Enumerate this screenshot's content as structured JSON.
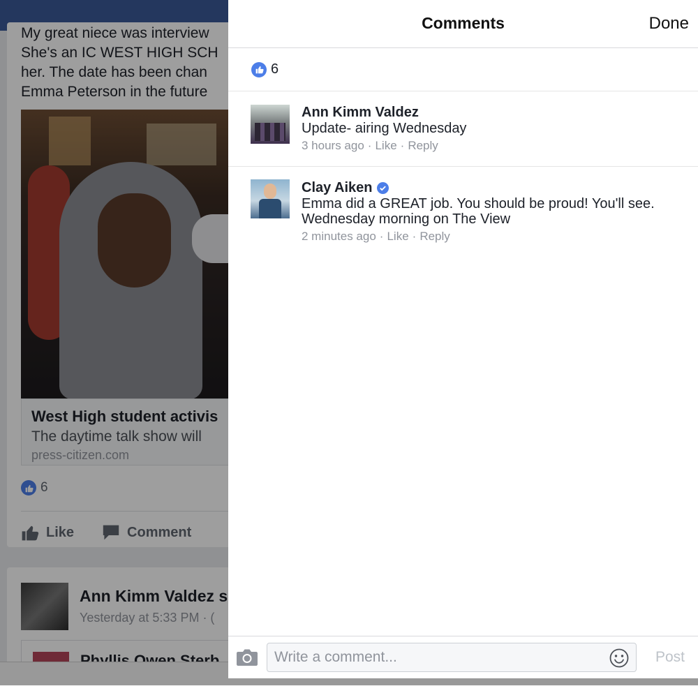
{
  "background_feed": {
    "post_text_lines": [
      "My great niece was interview",
      "She's an IC WEST HIGH SCH",
      "her. The date has been chan",
      "Emma Peterson in the future"
    ],
    "link_title": "West High student activis",
    "link_description": "The daytime talk show will",
    "link_domain": "press-citizen.com",
    "like_count": "6",
    "actions": {
      "like": "Like",
      "comment": "Comment"
    },
    "share_post": {
      "author": "Ann Kimm Valdez s",
      "time": "Yesterday at 5:33 PM · (",
      "sub_author": "Phyllis Owen Sterb"
    }
  },
  "comments_sheet": {
    "title": "Comments",
    "done_label": "Done",
    "like_count": "6",
    "comments": [
      {
        "author": "Ann Kimm Valdez",
        "verified": false,
        "text": "Update- airing Wednesday",
        "time": "3 hours ago",
        "like_label": "Like",
        "reply_label": "Reply"
      },
      {
        "author": "Clay Aiken",
        "verified": true,
        "text": "Emma did a GREAT job. You should be proud! You'll see. Wednesday morning on The View",
        "time": "2 minutes ago",
        "like_label": "Like",
        "reply_label": "Reply"
      }
    ],
    "composer": {
      "placeholder": "Write a comment...",
      "post_label": "Post",
      "camera_icon": "camera-icon",
      "emoji_icon": "smiley-icon"
    }
  },
  "colors": {
    "brand_blue": "#3b5998",
    "like_blue": "#4c7ee8",
    "meta_grey": "#90949c",
    "post_disabled": "#bec3c9"
  }
}
